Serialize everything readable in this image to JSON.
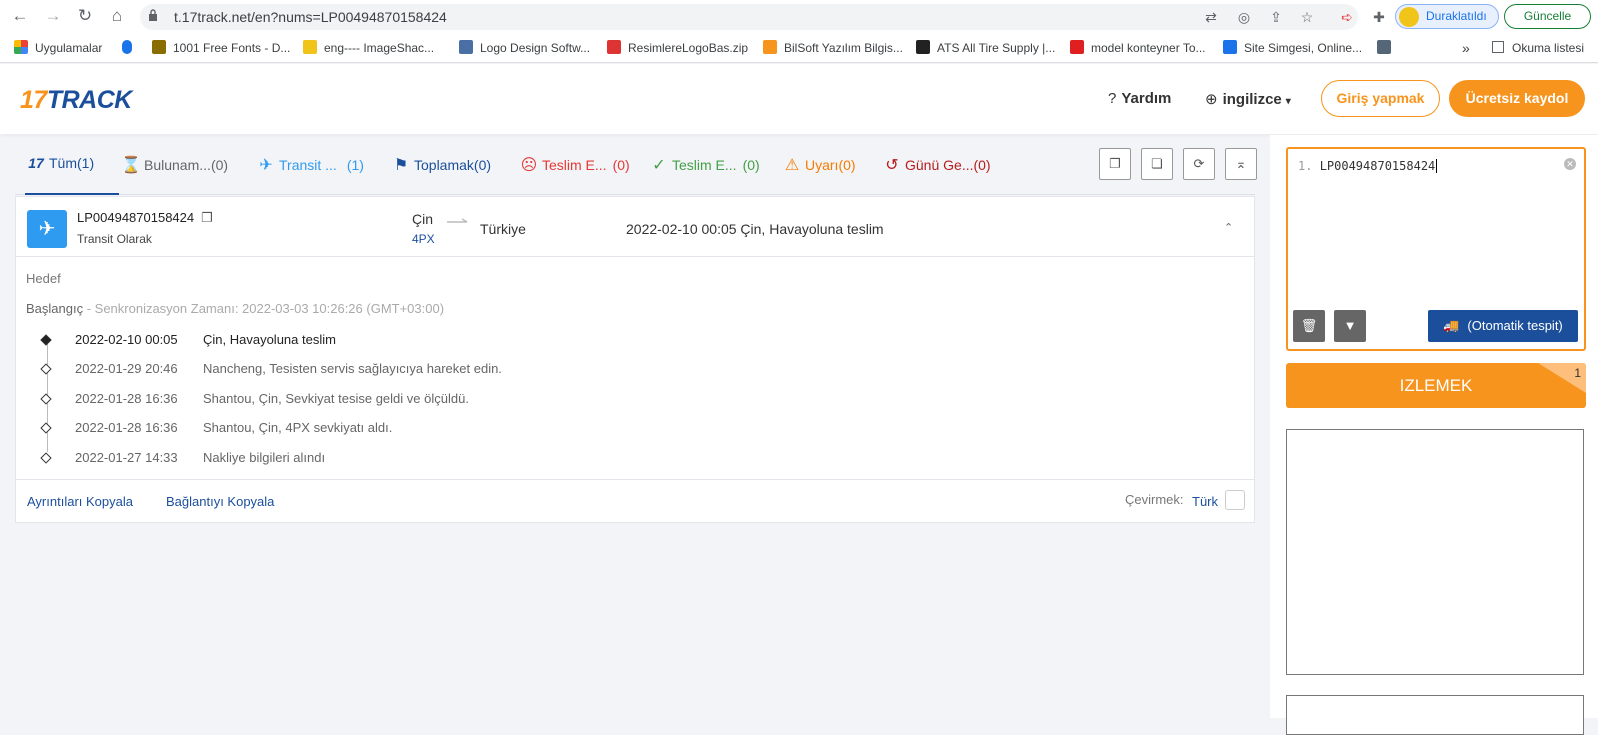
{
  "browser": {
    "url": "t.17track.net/en?nums=LP00494870158424",
    "profile_label": "Duraklatıldı",
    "update_label": "Güncelle",
    "nav": {
      "back": "←",
      "forward": "→",
      "reload": "↻",
      "home": "⌂"
    }
  },
  "bookmarks": {
    "apps_label": "Uygulamalar",
    "items": [
      {
        "label": "1001 Free Fonts - D...",
        "color": "#8a6d00"
      },
      {
        "label": "eng---- ImageShac...",
        "color": "#f0c419"
      },
      {
        "label": "Logo Design Softw...",
        "color": "#4a6fa5"
      },
      {
        "label": "ResimlereLogoBas.zip",
        "color": "#d33"
      },
      {
        "label": "BilSoft Yazılım Bilgis...",
        "color": "#f7941d"
      },
      {
        "label": "ATS All Tire Supply |...",
        "color": "#222"
      },
      {
        "label": "model konteyner To...",
        "color": "#e02020"
      },
      {
        "label": "Site Simgesi, Online...",
        "color": "#1a73e8"
      }
    ],
    "more": "»",
    "reading_list": "Okuma listesi"
  },
  "header": {
    "logo_num": "17",
    "logo_text": "TRACK",
    "help": "Yardım",
    "language": "ingilizce",
    "login": "Giriş yapmak",
    "register": "Ücretsiz kaydol"
  },
  "tabs": [
    {
      "label": "Tüm",
      "count": "(1)",
      "color": "#1b4f9c",
      "icon": "17"
    },
    {
      "label": "Bulunam...",
      "count": "(0)",
      "color": "#666",
      "icon": "⌛"
    },
    {
      "label": "Transit ...",
      "count": "(1)",
      "color": "#2f9bf0",
      "icon": "✈"
    },
    {
      "label": "Toplamak",
      "count": "(0)",
      "color": "#1b4f9c",
      "icon": "⚑"
    },
    {
      "label": "Teslim E...",
      "count": "(0)",
      "color": "#e53935",
      "icon": "☹"
    },
    {
      "label": "Teslim E...",
      "count": "(0)",
      "color": "#43a047",
      "icon": "✓"
    },
    {
      "label": "Uyarı",
      "count": "(0)",
      "color": "#f57c00",
      "icon": "⚠"
    },
    {
      "label": "Günü Ge...",
      "count": "(0)",
      "color": "#b71c1c",
      "icon": "↺"
    }
  ],
  "shipment": {
    "number": "LP00494870158424",
    "status": "Transit Olarak",
    "from": "Çin",
    "carrier": "4PX",
    "to": "Türkiye",
    "latest": "2022-02-10 00:05  Çin, Havayoluna teslim",
    "destination_label": "Hedef",
    "origin_label": "Başlangıç",
    "sync_text": " - Senkronizasyon Zamanı: 2022-03-03 10:26:26 (GMT+03:00)",
    "events": [
      {
        "time": "2022-02-10 00:05",
        "text": "Çin, Havayoluna teslim"
      },
      {
        "time": "2022-01-29 20:46",
        "text": "Nancheng, Tesisten servis sağlayıcıya hareket edin."
      },
      {
        "time": "2022-01-28 16:36",
        "text": "Shantou, Çin, Sevkiyat tesise geldi ve ölçüldü."
      },
      {
        "time": "2022-01-28 16:36",
        "text": "Shantou, Çin, 4PX sevkiyatı aldı."
      },
      {
        "time": "2022-01-27 14:33",
        "text": "Nakliye bilgileri alındı"
      }
    ],
    "copy_details": "Ayrıntıları Kopyala",
    "copy_link": "Bağlantıyı Kopyala",
    "translate_label": "Çevirmek:",
    "translate_lang": "Türk"
  },
  "side": {
    "line_num": "1.",
    "input_value": "LP00494870158424",
    "auto_detect": "(Otomatik tespit)",
    "track_button": "IZLEMEK",
    "track_count": "1"
  }
}
